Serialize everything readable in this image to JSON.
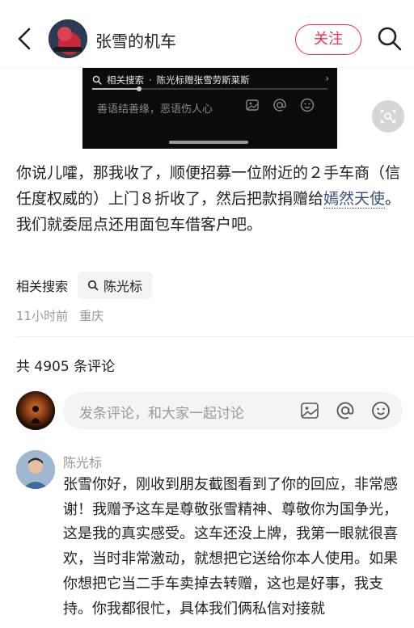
{
  "header": {
    "author_name": "张雪的机车",
    "follow_label": "关注"
  },
  "media": {
    "search_prefix": "相关搜索",
    "search_text": "陈光标赠张雪劳斯莱斯",
    "playback_progress": 0.2,
    "comment_placeholder": "善语结善缘，恶语伤人心"
  },
  "post": {
    "paragraph1_text": "你说儿嚯，那我收了，顺便招募一位附近的２手车商（信任度权威的）上门８折收了，然后把款捐赠给",
    "paragraph1_link": "嫣然天使",
    "paragraph1_end": "。",
    "paragraph2": "我们就委屈点还用面包车借客户吧。",
    "related_label": "相关搜索",
    "related_chip": "陈光标",
    "time_ago": "11小时前",
    "location": "重庆"
  },
  "comments": {
    "count_label": "共 4905 条评论",
    "input_placeholder": "发条评论，和大家一起讨论",
    "items": [
      {
        "author": "陈光标",
        "text": "张雪你好，刚收到朋友截图看到了你的回应，非常感谢！我赠予这车是尊敬张雪精神、尊敬你为国争光，这是我的真实感受。这车还没上牌，我第一眼就很喜欢，当时非常激动，就想把它送给你本人使用。如果你想把它当二手车卖掉去转赠，这也是好事，我支持。你我都很忙，具体我们俩私信对接就"
      }
    ]
  },
  "colors": {
    "accent": "#e8334a",
    "link": "#3a4f7c",
    "muted": "#999999"
  },
  "icons": [
    "back-icon",
    "search-icon",
    "image-icon",
    "at-icon",
    "emoji-icon",
    "scan-icon"
  ]
}
